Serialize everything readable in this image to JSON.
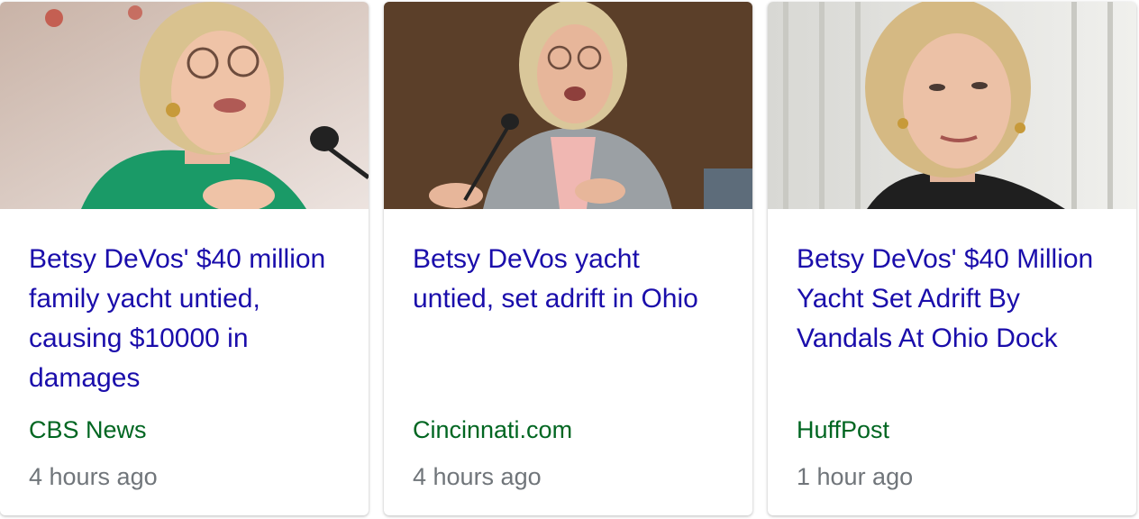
{
  "colors": {
    "headline": "#1a0dab",
    "source": "#006621",
    "timestamp": "#70757a"
  },
  "cards": [
    {
      "headline": "Betsy DeVos' $40 million family yacht untied, causing $10000 in damages",
      "source": "CBS News",
      "time": "4 hours ago",
      "image": "news-photo"
    },
    {
      "headline": "Betsy DeVos yacht untied, set adrift in Ohio",
      "source": "Cincinnati.com",
      "time": "4 hours ago",
      "image": "news-photo"
    },
    {
      "headline": "Betsy DeVos' $40 Million Yacht Set Adrift By Vandals At Ohio Dock",
      "source": "HuffPost",
      "time": "1 hour ago",
      "image": "news-photo"
    }
  ]
}
